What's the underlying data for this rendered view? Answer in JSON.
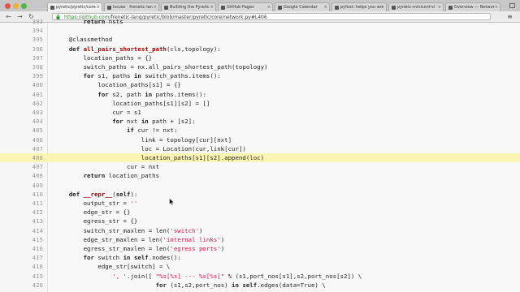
{
  "browser": {
    "tabs": [
      {
        "label": "pyretic/pyretic/core",
        "active": true
      },
      {
        "label": "Issues · frenetic-lan",
        "active": false
      },
      {
        "label": "Building the Pyretic",
        "active": false
      },
      {
        "label": "GitHub Pages",
        "active": false
      },
      {
        "label": "Google Calendar",
        "active": false
      },
      {
        "label": "pyfest: helps you wri",
        "active": false
      },
      {
        "label": "pyretic-miniconf-sl",
        "active": false
      },
      {
        "label": "Overview — Networ",
        "active": false
      }
    ],
    "address": {
      "host": "https://github.com",
      "path": "/frenetic-lang/pyretic/blob/master/pyretic/core/network.py#L406"
    }
  },
  "code": {
    "lines": [
      {
        "num": "393",
        "text": "        return nsts",
        "highlight": false
      },
      {
        "num": "394",
        "text": "",
        "highlight": false
      },
      {
        "num": "395",
        "text": "    @classmethod",
        "highlight": false
      },
      {
        "num": "396",
        "text": "    def all_pairs_shortest_path(cls,topology):",
        "highlight": false
      },
      {
        "num": "397",
        "text": "        location_paths = {}",
        "highlight": false
      },
      {
        "num": "398",
        "text": "        switch_paths = nx.all_pairs_shortest_path(topology)",
        "highlight": false
      },
      {
        "num": "399",
        "text": "        for s1, paths in switch_paths.items():",
        "highlight": false
      },
      {
        "num": "400",
        "text": "            location_paths[s1] = {}",
        "highlight": false
      },
      {
        "num": "401",
        "text": "            for s2, path in paths.items():",
        "highlight": false
      },
      {
        "num": "402",
        "text": "                location_paths[s1][s2] = []",
        "highlight": false
      },
      {
        "num": "403",
        "text": "                cur = s1",
        "highlight": false
      },
      {
        "num": "404",
        "text": "                for nxt in path + [s2]:",
        "highlight": false
      },
      {
        "num": "405",
        "text": "                    if cur != nxt:",
        "highlight": false
      },
      {
        "num": "406",
        "text": "                        link = topology[cur][nxt]",
        "highlight": false
      },
      {
        "num": "407",
        "text": "                        loc = Location(cur,link[cur])",
        "highlight": false
      },
      {
        "num": "406",
        "text": "                        location_paths[s1][s2].append(loc)",
        "highlight": true
      },
      {
        "num": "407",
        "text": "                    cur = nxt",
        "highlight": false
      },
      {
        "num": "408",
        "text": "        return location_paths",
        "highlight": false
      },
      {
        "num": "409",
        "text": "",
        "highlight": false
      },
      {
        "num": "410",
        "text": "    def __repr__(self):",
        "highlight": false
      },
      {
        "num": "411",
        "text": "        output_str = ''",
        "highlight": false
      },
      {
        "num": "412",
        "text": "        edge_str = {}",
        "highlight": false
      },
      {
        "num": "413",
        "text": "        egress_str = {}",
        "highlight": false
      },
      {
        "num": "414",
        "text": "        switch_str_maxlen = len('switch')",
        "highlight": false
      },
      {
        "num": "415",
        "text": "        edge_str_maxlen = len('internal links')",
        "highlight": false
      },
      {
        "num": "416",
        "text": "        egress_str_maxlen = len('egress ports')",
        "highlight": false
      },
      {
        "num": "417",
        "text": "        for switch in self.nodes():",
        "highlight": false
      },
      {
        "num": "418",
        "text": "            edge_str[switch] = \\",
        "highlight": false
      },
      {
        "num": "419",
        "text": "                ', '.join([ \"%s[%s] --- %s[%s]\" % (s1,port_nos[s1],s2,port_nos[s2]) \\",
        "highlight": false
      },
      {
        "num": "420",
        "text": "                            for (s1,s2,port_nos) in self.edges(data=True) \\",
        "highlight": false
      }
    ]
  },
  "colors": {
    "highlight": "#fbf5b3",
    "keyword": "#222222",
    "function_name": "#990000",
    "string": "#dd1144",
    "line_number": "#9a9a9a"
  }
}
